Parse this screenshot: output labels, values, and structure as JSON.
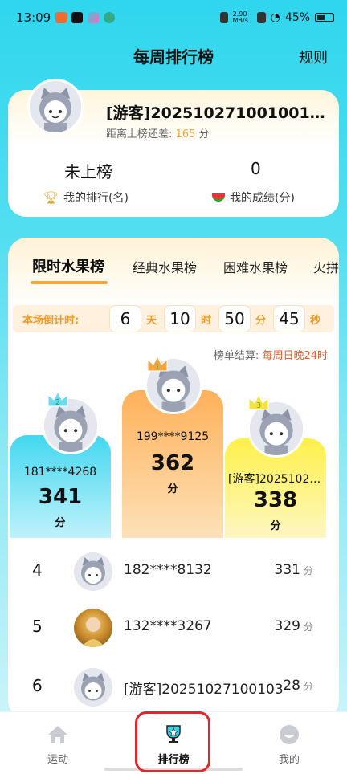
{
  "status_bar": {
    "time": "13:09",
    "net_speed": "2.90\nMB/s",
    "battery": "45%"
  },
  "header": {
    "title": "每周排行榜",
    "rules_label": "规则"
  },
  "user": {
    "name": "[游客]20251027100100145…",
    "gap_label": "距离上榜还差:",
    "gap_value": "165",
    "gap_unit": "分",
    "rank_value": "未上榜",
    "rank_label": "我的排行(名)",
    "score_value": "0",
    "score_label": "我的成绩(分)"
  },
  "tabs": [
    "限时水果榜",
    "经典水果榜",
    "困难水果榜",
    "火拼"
  ],
  "active_tab": 0,
  "countdown": {
    "label": "本场倒计时:",
    "days": "6",
    "days_unit": "天",
    "hours": "10",
    "hours_unit": "时",
    "minutes": "50",
    "minutes_unit": "分",
    "seconds": "45",
    "seconds_unit": "秒"
  },
  "settle": {
    "label": "榜单结算:",
    "value": "每周日晚24时"
  },
  "podium": {
    "first": {
      "rank": "1",
      "name": "199****9125",
      "score": "362",
      "unit": "分"
    },
    "second": {
      "rank": "2",
      "name": "181****4268",
      "score": "341",
      "unit": "分"
    },
    "third": {
      "rank": "3",
      "name": "[游客]20251027…",
      "score": "338",
      "unit": "分"
    }
  },
  "rankings": [
    {
      "rank": "4",
      "name": "182****8132",
      "score": "331",
      "unit": "分"
    },
    {
      "rank": "5",
      "name": "132****3267",
      "score": "329",
      "unit": "分"
    },
    {
      "rank": "6",
      "name": "[游客]20251027100103",
      "score": "28",
      "unit": "分"
    }
  ],
  "bottom_nav": {
    "items": [
      {
        "label": "运动",
        "icon": "home-icon"
      },
      {
        "label": "排行榜",
        "icon": "trophy-icon"
      },
      {
        "label": "我的",
        "icon": "profile-icon"
      }
    ],
    "active": 1
  },
  "colors": {
    "accent_orange": "#f4a63a",
    "highlight_red": "#e2262e",
    "podium_first": "#ffb15a",
    "podium_second": "#43d7ef",
    "podium_third": "#fff04a"
  }
}
